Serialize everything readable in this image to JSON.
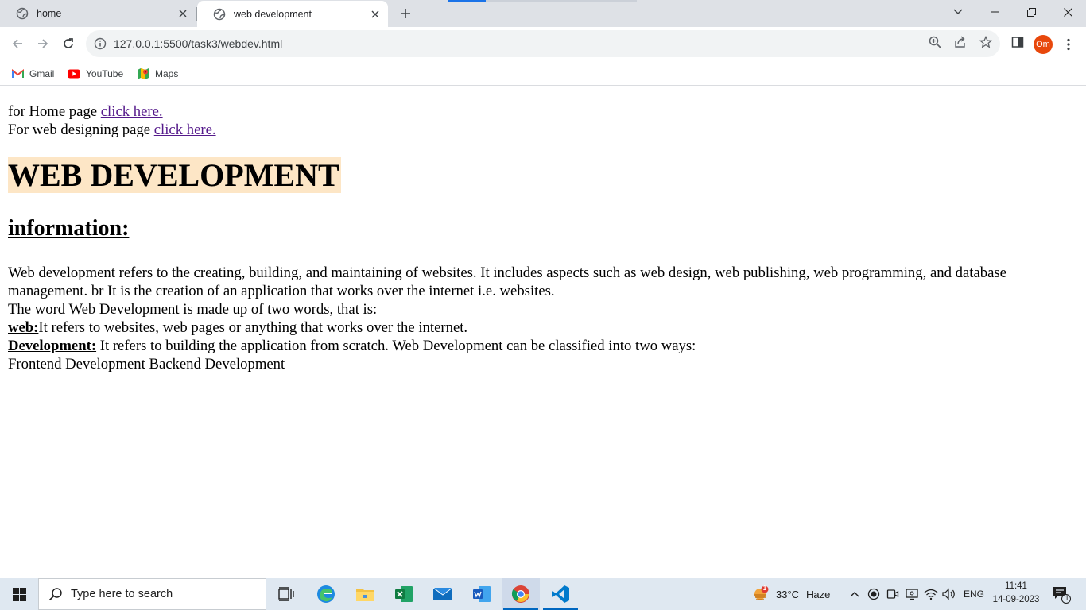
{
  "browser": {
    "tabs": [
      {
        "label": "home",
        "active": false
      },
      {
        "label": "web development",
        "active": true
      }
    ],
    "url": "127.0.0.1:5500/task3/webdev.html",
    "profile_initials": "Om",
    "bookmarks": [
      {
        "label": "Gmail",
        "icon": "gmail-icon"
      },
      {
        "label": "YouTube",
        "icon": "youtube-icon"
      },
      {
        "label": "Maps",
        "icon": "maps-icon"
      }
    ]
  },
  "page": {
    "home_prefix": "for Home page ",
    "home_link": "click here.",
    "design_prefix": "For web designing page ",
    "design_link": "click here.",
    "heading": "WEB DEVELOPMENT",
    "heading_bg": "#fde6c6",
    "subheading": "information:",
    "para1": "Web development refers to the creating, building, and maintaining of websites. It includes aspects such as web design, web publishing, web programming, and database management. br It is the creation of an application that works over the internet i.e. websites.",
    "para2": "The word Web Development is made up of two words, that is:",
    "web_term": "web:",
    "web_def": "It refers to websites, web pages or anything that works over the internet.",
    "dev_term": "Development:",
    "dev_def": " It refers to building the application from scratch. Web Development can be classified into two ways:",
    "para3": "Frontend Development Backend Development"
  },
  "taskbar": {
    "search_placeholder": "Type here to search",
    "weather_temp": "33°C",
    "weather_desc": "Haze",
    "weather_badge": "1",
    "language": "ENG",
    "time": "11:41",
    "date": "14-09-2023",
    "notification_count": "1"
  }
}
